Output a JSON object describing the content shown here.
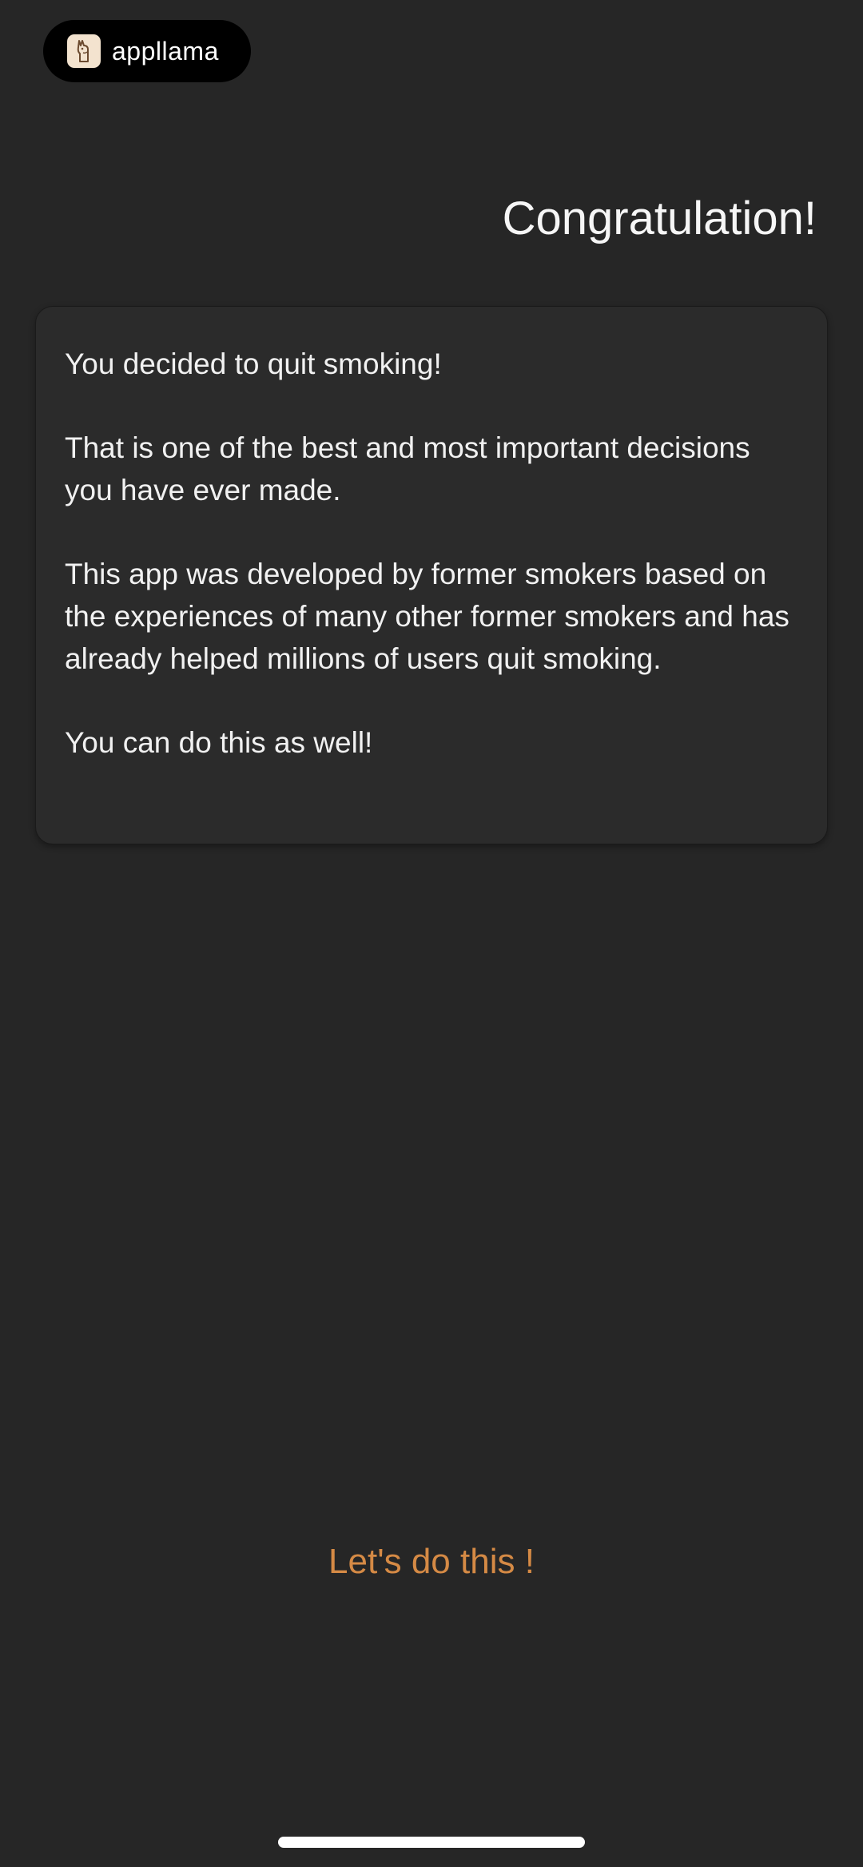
{
  "brand": {
    "name": "appllama",
    "logo_icon": "llama-icon",
    "logo_bg": "#f3e3cf"
  },
  "page": {
    "title": "Congratulation!"
  },
  "message": {
    "paragraphs": [
      "You decided to quit smoking!",
      "That is one of the best and most important decisions you have ever made.",
      "This app was developed by former smokers based on the experiences of many other former smokers and has already helped millions of users quit smoking.",
      "You can do this as well!"
    ]
  },
  "action": {
    "label": "Let's do this !",
    "color": "#d58a45"
  },
  "colors": {
    "background": "#262626",
    "card": "#2b2b2b",
    "text": "#f1f1f1"
  }
}
